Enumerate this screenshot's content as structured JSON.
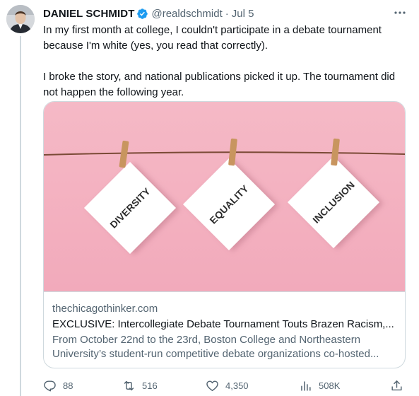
{
  "author": {
    "name": "DANIEL SCHMIDT",
    "handle": "@realdschmidt",
    "separator": "·",
    "date": "Jul 5"
  },
  "tweet": {
    "text": "In my first month at college, I couldn't participate in a debate tournament because I'm white (yes, you read that correctly).\n\nI broke the story, and national publications picked it up. The tournament did not happen the following year."
  },
  "card": {
    "image_words": [
      "DIVERSITY",
      "EQUALITY",
      "INCLUSION"
    ],
    "domain": "thechicagothinker.com",
    "title": "EXCLUSIVE: Intercollegiate Debate Tournament Touts Brazen Racism,...",
    "description_line1": "From October 22nd to the 23rd, Boston College and Northeastern",
    "description_line2": "University’s student-run competitive debate organizations co-hosted..."
  },
  "actions": {
    "replies": "88",
    "retweets": "516",
    "likes": "4,350",
    "views": "508K"
  },
  "colors": {
    "verified": "#1d9bf0",
    "secondary_text": "#536471",
    "border": "#cfd9de",
    "card_background": "#f3b2c1"
  },
  "icons": [
    "verified-badge-icon",
    "more-icon",
    "reply-icon",
    "retweet-icon",
    "like-icon",
    "views-icon",
    "share-icon"
  ]
}
